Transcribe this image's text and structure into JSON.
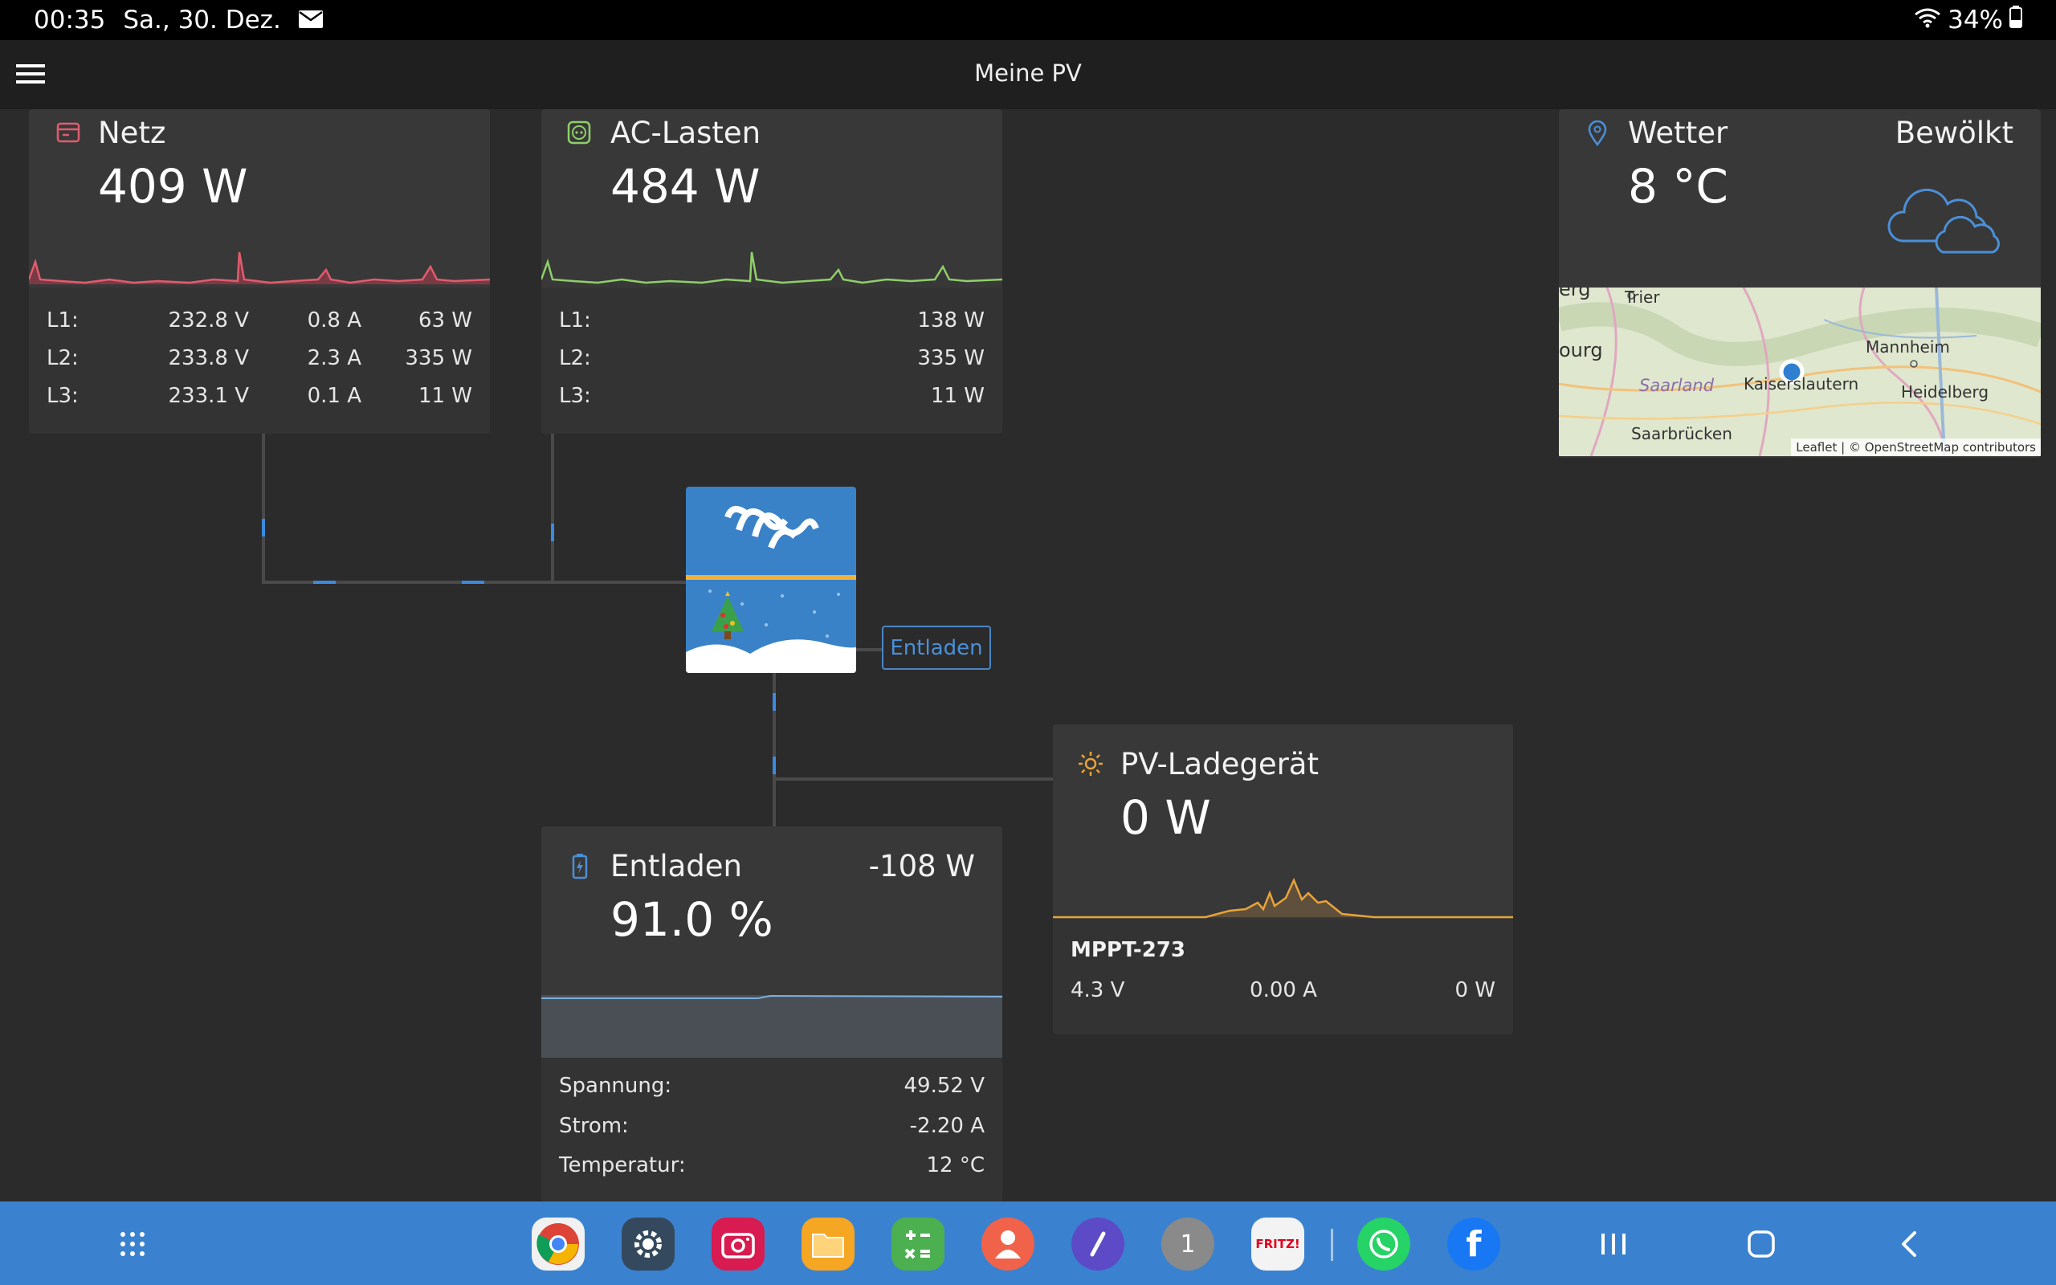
{
  "status_bar": {
    "time": "00:35",
    "date": "Sa., 30. Dez.",
    "battery": "34%",
    "icons": [
      "mail-icon",
      "wifi-icon",
      "battery-icon"
    ]
  },
  "header": {
    "title": "Meine PV",
    "menu_icon": "hamburger-menu-icon"
  },
  "grid": {
    "title": "Netz",
    "value": "409 W",
    "accent": "#e05c6e",
    "phases": [
      {
        "label": "L1:",
        "voltage": "232.8 V",
        "current": "0.8 A",
        "power": "63 W"
      },
      {
        "label": "L2:",
        "voltage": "233.8 V",
        "current": "2.3 A",
        "power": "335 W"
      },
      {
        "label": "L3:",
        "voltage": "233.1 V",
        "current": "0.1 A",
        "power": "11 W"
      }
    ]
  },
  "ac_loads": {
    "title": "AC-Lasten",
    "value": "484 W",
    "accent": "#8fcf6a",
    "phases": [
      {
        "label": "L1:",
        "power": "138 W"
      },
      {
        "label": "L2:",
        "power": "335 W"
      },
      {
        "label": "L3:",
        "power": "11 W"
      }
    ]
  },
  "weather": {
    "title": "Wetter",
    "condition": "Bewölkt",
    "temperature": "8 °C",
    "map_labels": {
      "trier": "Trier",
      "mannheim": "Mannheim",
      "saarland": "Saarland",
      "kaiserslautern": "Kaiserslautern",
      "heidelberg": "Heidelberg",
      "saarbruecken": "Saarbrücken",
      "luxembourg_fragment": "ourg",
      "top_fragment": "erg"
    },
    "attribution": "Leaflet | © OpenStreetMap contributors"
  },
  "inverter": {
    "status": "Entladen"
  },
  "battery": {
    "title": "Entladen",
    "power": "-108 W",
    "soc": "91.0 %",
    "soc_fraction": 0.91,
    "details": [
      {
        "label": "Spannung:",
        "value": "49.52 V"
      },
      {
        "label": "Strom:",
        "value": "-2.20 A"
      },
      {
        "label": "Temperatur:",
        "value": "12 °C"
      }
    ]
  },
  "pv_charger": {
    "title": "PV-Ladegerät",
    "value": "0 W",
    "accent": "#e8a33a",
    "device": "MPPT-273",
    "voltage": "4.3 V",
    "current": "0.00 A",
    "power": "0 W"
  },
  "dock": {
    "apps": [
      "chrome-icon",
      "settings-icon",
      "camera-icon",
      "files-icon",
      "calculator-icon",
      "contacts-icon",
      "compass-icon",
      "chrome-badge-icon",
      "fritz-icon",
      "whatsapp-icon",
      "facebook-icon"
    ],
    "badge_count": "1",
    "fritz_label": "FRITZ!"
  }
}
